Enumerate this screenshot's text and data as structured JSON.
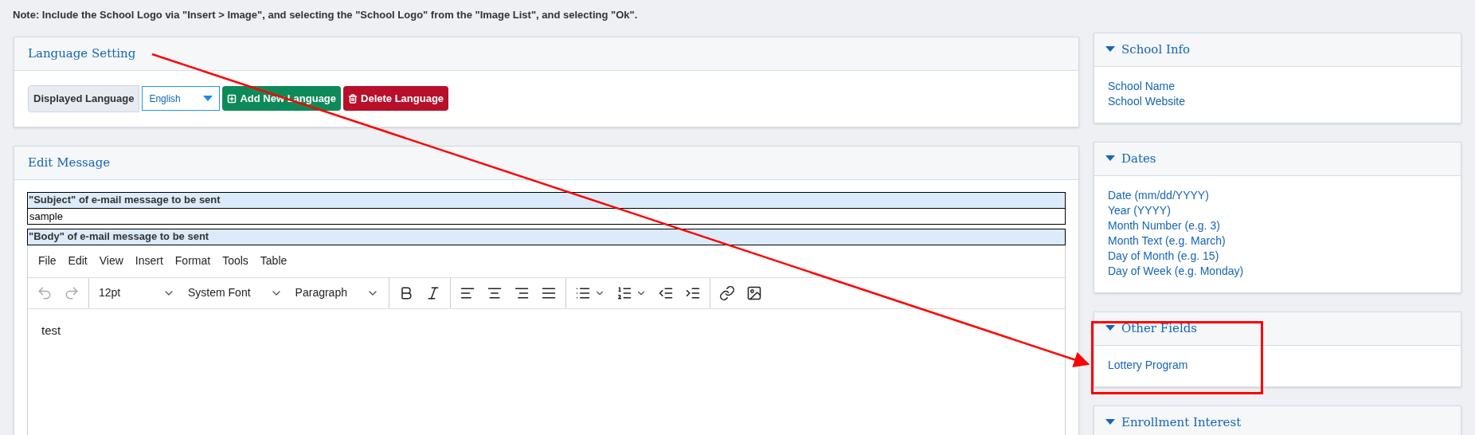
{
  "note": "Note: Include the School Logo via \"Insert > Image\", and selecting the \"School Logo\" from the \"Image List\", and selecting \"Ok\".",
  "language_setting": {
    "title": "Language Setting",
    "label": "Displayed Language",
    "select_value": "English",
    "buttons": [
      {
        "kind": "add",
        "label": "Add New Language"
      },
      {
        "kind": "delete",
        "label": "Delete Language"
      }
    ]
  },
  "edit_message": {
    "title": "Edit Message",
    "subject_label": "\"Subject\" of e-mail message to be sent",
    "subject_value": "sample",
    "body_label": "\"Body\" of e-mail message to be sent",
    "menu": [
      "File",
      "Edit",
      "View",
      "Insert",
      "Format",
      "Tools",
      "Table"
    ],
    "toolbar": [
      {
        "kind": "undo",
        "disabled": true
      },
      {
        "kind": "redo",
        "disabled": true
      },
      {
        "kind": "sep"
      },
      {
        "kind": "dropdown",
        "label": "12pt"
      },
      {
        "kind": "dropdown",
        "label": "System Font"
      },
      {
        "kind": "dropdown",
        "label": "Paragraph"
      },
      {
        "kind": "sep"
      },
      {
        "kind": "bold",
        "disabled": false
      },
      {
        "kind": "italic",
        "disabled": false
      },
      {
        "kind": "sep"
      },
      {
        "kind": "align-left",
        "disabled": false
      },
      {
        "kind": "align-center",
        "disabled": false
      },
      {
        "kind": "align-right",
        "disabled": false
      },
      {
        "kind": "align-justify",
        "disabled": false
      },
      {
        "kind": "sep"
      },
      {
        "kind": "bullet-list",
        "disabled": false
      },
      {
        "kind": "number-list",
        "disabled": false
      },
      {
        "kind": "outdent",
        "disabled": false
      },
      {
        "kind": "indent",
        "disabled": false
      },
      {
        "kind": "sep"
      },
      {
        "kind": "link",
        "disabled": false
      },
      {
        "kind": "image",
        "disabled": false
      }
    ],
    "body_text": "test"
  },
  "side_panels": [
    {
      "title": "School Info",
      "expanded": true,
      "items": [
        "School Name",
        "School Website"
      ]
    },
    {
      "title": "Dates",
      "expanded": true,
      "items": [
        "Date (mm/dd/YYYY)",
        "Year (YYYY)",
        "Month Number (e.g. 3)",
        "Month Text (e.g. March)",
        "Day of Month (e.g. 15)",
        "Day of Week (e.g. Monday)"
      ]
    },
    {
      "title": "Other Fields",
      "expanded": true,
      "items": [
        "Lottery Program"
      ]
    },
    {
      "title": "Enrollment Interest",
      "expanded": true
    }
  ]
}
